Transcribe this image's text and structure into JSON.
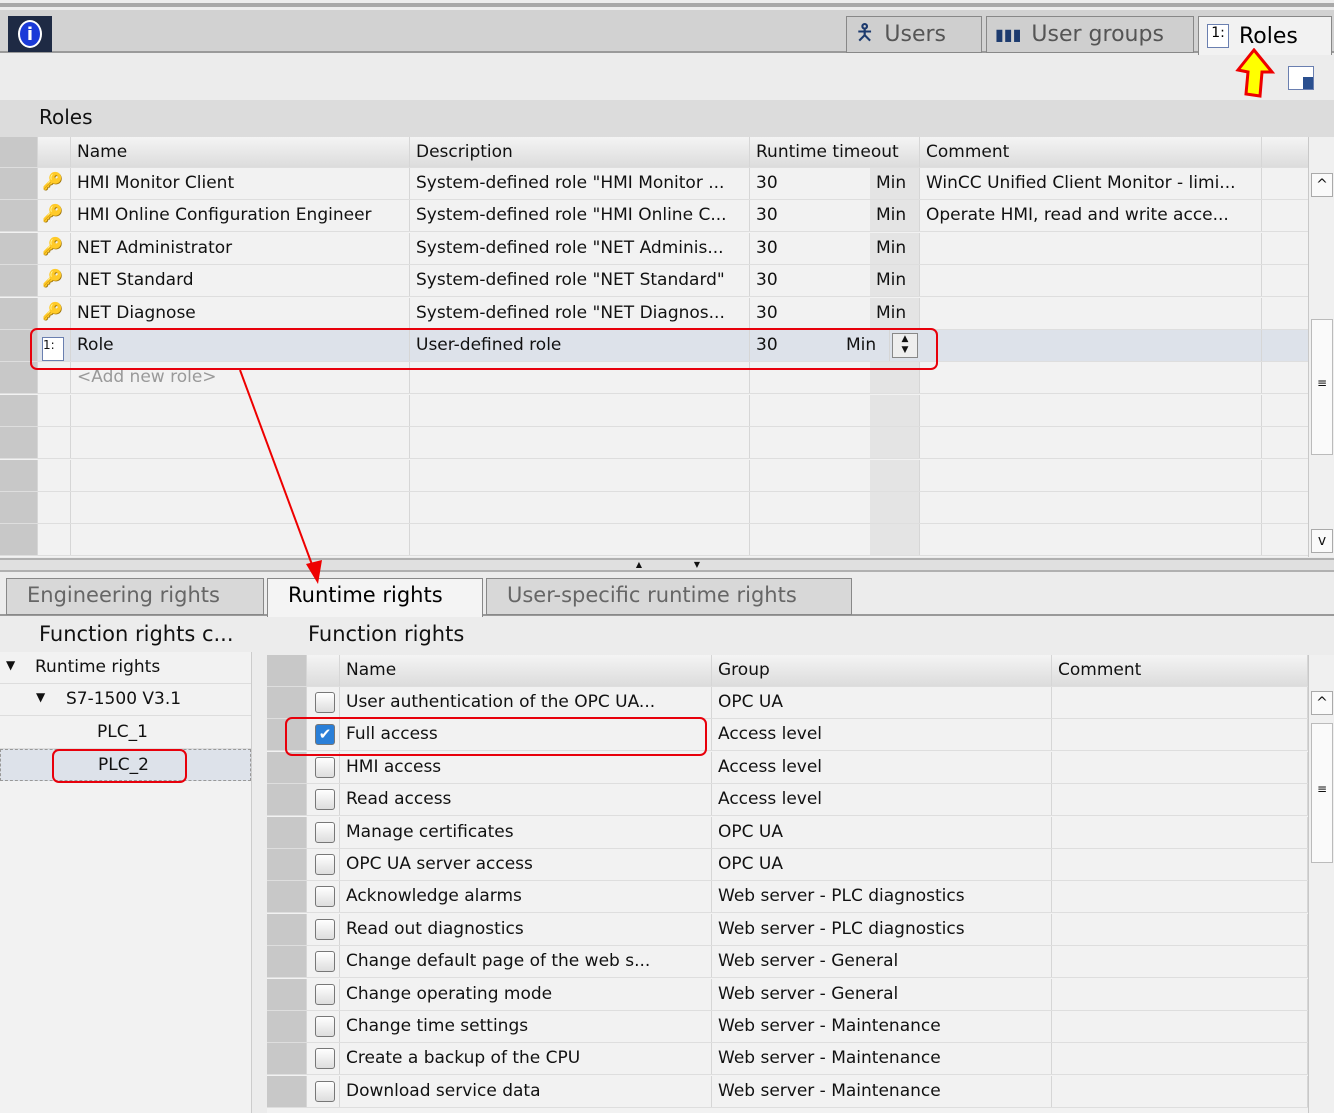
{
  "top_tabs": [
    {
      "label": "Users",
      "icon": "user-icon"
    },
    {
      "label": "User groups",
      "icon": "user-groups-icon"
    },
    {
      "label": "Roles",
      "icon": "roles-icon"
    }
  ],
  "roles": {
    "title": "Roles",
    "columns": [
      "Name",
      "Description",
      "Runtime timeout",
      "Comment"
    ],
    "rows": [
      {
        "name": "HMI Monitor Client",
        "description": "System-defined role \"HMI Monitor ...",
        "timeout": "30",
        "unit": "Min",
        "comment": "WinCC Unified Client Monitor - limi..."
      },
      {
        "name": "HMI Online Configuration Engineer",
        "description": "System-defined role \"HMI Online C...",
        "timeout": "30",
        "unit": "Min",
        "comment": "Operate HMI, read and write acce..."
      },
      {
        "name": "NET Administrator",
        "description": "System-defined role \"NET Adminis...",
        "timeout": "30",
        "unit": "Min",
        "comment": ""
      },
      {
        "name": "NET Standard",
        "description": "System-defined role \"NET Standard\"",
        "timeout": "30",
        "unit": "Min",
        "comment": ""
      },
      {
        "name": "NET Diagnose",
        "description": "System-defined role \"NET Diagnos...",
        "timeout": "30",
        "unit": "Min",
        "comment": ""
      },
      {
        "name": "Role",
        "description": "User-defined role",
        "timeout": "30",
        "unit": "Min",
        "comment": ""
      }
    ],
    "add_new": "<Add new role>"
  },
  "bottom_tabs": [
    "Engineering rights",
    "Runtime rights",
    "User-specific runtime rights"
  ],
  "categories": {
    "title": "Function rights c...",
    "tree": [
      {
        "label": "Runtime rights",
        "level": 0
      },
      {
        "label": "S7-1500 V3.1",
        "level": 1
      },
      {
        "label": "PLC_1",
        "level": 2
      },
      {
        "label": "PLC_2",
        "level": 2
      }
    ]
  },
  "rights": {
    "title": "Function rights",
    "columns": [
      "Name",
      "Group",
      "Comment"
    ],
    "rows": [
      {
        "name": "User authentication of the OPC UA...",
        "group": "OPC UA",
        "checked": false
      },
      {
        "name": "Full access",
        "group": "Access level",
        "checked": true
      },
      {
        "name": "HMI access",
        "group": "Access level",
        "checked": false
      },
      {
        "name": "Read access",
        "group": "Access level",
        "checked": false
      },
      {
        "name": "Manage certificates",
        "group": "OPC UA",
        "checked": false
      },
      {
        "name": "OPC UA server access",
        "group": "OPC UA",
        "checked": false
      },
      {
        "name": "Acknowledge alarms",
        "group": "Web server - PLC diagnostics",
        "checked": false
      },
      {
        "name": "Read out diagnostics",
        "group": "Web server - PLC diagnostics",
        "checked": false
      },
      {
        "name": "Change default page of the web s...",
        "group": "Web server - General",
        "checked": false
      },
      {
        "name": "Change operating mode",
        "group": "Web server - General",
        "checked": false
      },
      {
        "name": "Change time settings",
        "group": "Web server - Maintenance",
        "checked": false
      },
      {
        "name": "Create a backup of the CPU",
        "group": "Web server - Maintenance",
        "checked": false
      },
      {
        "name": "Download service data",
        "group": "Web server - Maintenance",
        "checked": false
      }
    ]
  }
}
